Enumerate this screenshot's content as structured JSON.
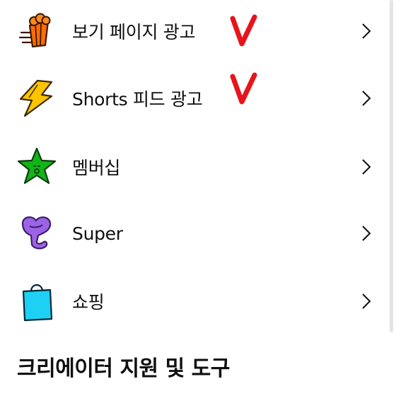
{
  "menu": {
    "items": [
      {
        "label": "보기 페이지 광고",
        "icon": "popcorn-icon"
      },
      {
        "label": "Shorts 피드 광고",
        "icon": "lightning-icon"
      },
      {
        "label": "멤버십",
        "icon": "star-icon"
      },
      {
        "label": "Super",
        "icon": "heart-icon"
      },
      {
        "label": "쇼핑",
        "icon": "shopping-bag-icon"
      }
    ]
  },
  "annotations": {
    "check_mark_color": "#e8141b"
  },
  "section": {
    "title": "크리에이터 지원 및 도구"
  }
}
